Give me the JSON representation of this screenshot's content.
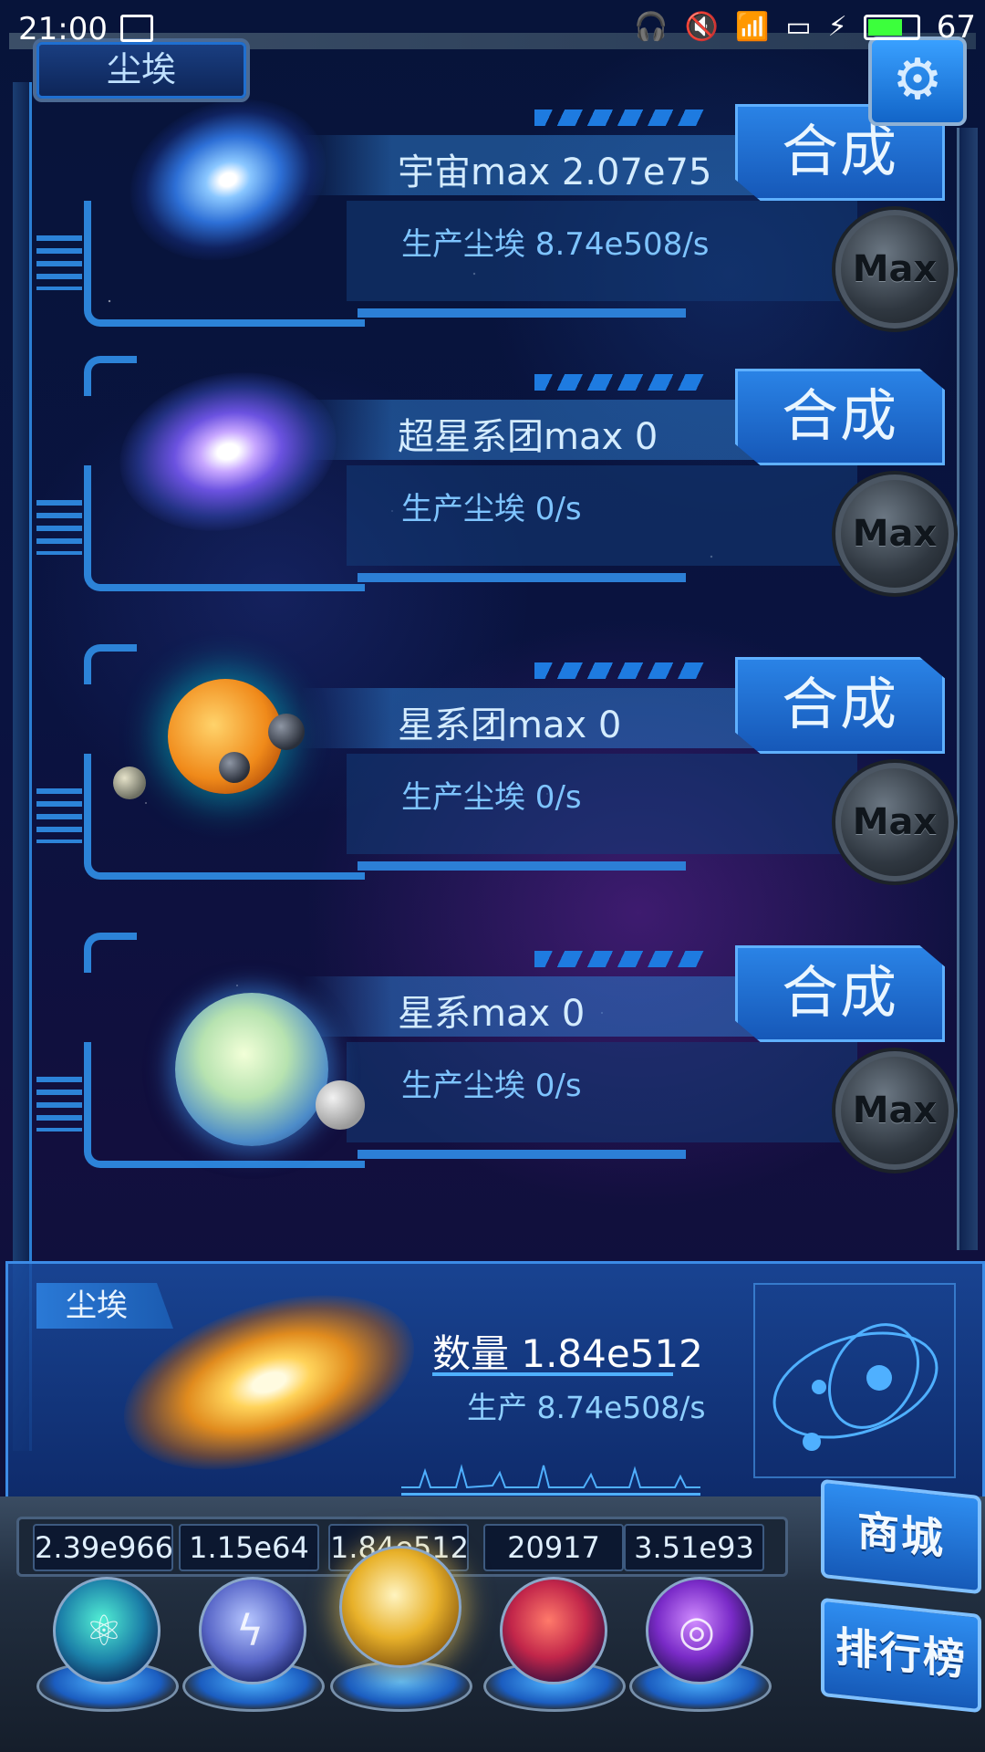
{
  "status_bar": {
    "time": "21:00",
    "icons": [
      "image-icon",
      "headphones-icon",
      "mute-icon",
      "wifi-icon",
      "screen-icon",
      "charging-icon",
      "battery-icon"
    ],
    "battery_percent": "67",
    "battery_level": 0.67,
    "battery_color": "#3cff3c"
  },
  "header": {
    "title": "尘埃",
    "settings_icon": "gear-icon"
  },
  "items": [
    {
      "title": "宇宙max 2.07e75",
      "production": "生产尘埃  8.74e508/s",
      "synth_label": "合成",
      "max_label": "Max",
      "art": "blue-galaxy-icon"
    },
    {
      "title": "超星系团max 0",
      "production": "生产尘埃  0/s",
      "synth_label": "合成",
      "max_label": "Max",
      "art": "violet-galaxy-icon"
    },
    {
      "title": "星系团max 0",
      "production": "生产尘埃  0/s",
      "synth_label": "合成",
      "max_label": "Max",
      "art": "solar-system-icon"
    },
    {
      "title": "星系max 0",
      "production": "生产尘埃  0/s",
      "synth_label": "合成",
      "max_label": "Max",
      "art": "planet-icon"
    }
  ],
  "dust_panel": {
    "tag": "尘埃",
    "count": "数量 1.84e512",
    "production": "生产 8.74e508/s"
  },
  "resources": [
    {
      "value": "2.39e966",
      "icon": "atom-orb-icon"
    },
    {
      "value": "1.15e64",
      "icon": "lightning-orb-icon"
    },
    {
      "value": "1.84e512",
      "icon": "dust-orb-icon"
    },
    {
      "value": "20917",
      "icon": "brain-orb-icon"
    },
    {
      "value": "3.51e93",
      "icon": "vortex-orb-icon"
    }
  ],
  "side_buttons": {
    "shop": "商城",
    "rank": "排行榜"
  },
  "colors": {
    "accent": "#2c83d8",
    "button_blue": "#2a83e6",
    "background": "#07143a"
  }
}
